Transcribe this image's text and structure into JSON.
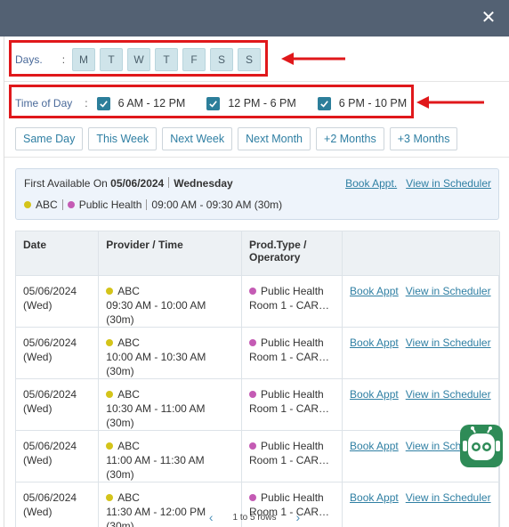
{
  "header": {
    "close_icon": "close-icon"
  },
  "days": {
    "label": "Days.",
    "colon": ":",
    "items": [
      "M",
      "T",
      "W",
      "T",
      "F",
      "S",
      "S"
    ]
  },
  "time_of_day": {
    "label": "Time of Day",
    "colon": ":",
    "options": [
      {
        "label": "6 AM - 12 PM",
        "checked": true
      },
      {
        "label": "12 PM - 6 PM",
        "checked": true
      },
      {
        "label": "6 PM - 10 PM",
        "checked": true
      }
    ]
  },
  "ranges": [
    "Same Day",
    "This Week",
    "Next Week",
    "Next Month",
    "+2 Months",
    "+3 Months"
  ],
  "first_available": {
    "prefix": "First Available On",
    "date": "05/06/2024",
    "day": "Wednesday",
    "provider": "ABC",
    "service": "Public Health",
    "time": "09:00 AM - 09:30 AM (30m)",
    "book_label": "Book Appt.",
    "view_label": "View in Scheduler"
  },
  "table": {
    "headers": [
      "Date",
      "Provider / Time",
      "Prod.Type / Operatory",
      ""
    ],
    "rows": [
      {
        "date": "05/06/2024",
        "dow": "(Wed)",
        "provider": "ABC",
        "time": "09:30 AM - 10:00 AM (30m)",
        "type": "Public Health",
        "operatory": "Room 1 - CARE...",
        "book": "Book Appt",
        "view": "View in Scheduler"
      },
      {
        "date": "05/06/2024",
        "dow": "(Wed)",
        "provider": "ABC",
        "time": "10:00 AM - 10:30 AM (30m)",
        "type": "Public Health",
        "operatory": "Room 1 - CARE...",
        "book": "Book Appt",
        "view": "View in Scheduler"
      },
      {
        "date": "05/06/2024",
        "dow": "(Wed)",
        "provider": "ABC",
        "time": "10:30 AM - 11:00 AM (30m)",
        "type": "Public Health",
        "operatory": "Room 1 - CARE...",
        "book": "Book Appt",
        "view": "View in Scheduler"
      },
      {
        "date": "05/06/2024",
        "dow": "(Wed)",
        "provider": "ABC",
        "time": "11:00 AM - 11:30 AM (30m)",
        "type": "Public Health",
        "operatory": "Room 1 - CARE...",
        "book": "Book Appt",
        "view": "View in Scheduler"
      },
      {
        "date": "05/06/2024",
        "dow": "(Wed)",
        "provider": "ABC",
        "time": "11:30 AM - 12:00 PM (30m)",
        "type": "Public Health",
        "operatory": "Room 1 - CARE...",
        "book": "Book Appt",
        "view": "View in Scheduler"
      }
    ]
  },
  "pager": {
    "text": "1 to 5 rows"
  },
  "colors": {
    "header_bg": "#536173",
    "accent": "#2f7fa3",
    "provider_dot": "#d4c41a",
    "service_dot": "#c45bb4",
    "annotation_red": "#e0181b",
    "bot_bg": "#2e8b57"
  }
}
